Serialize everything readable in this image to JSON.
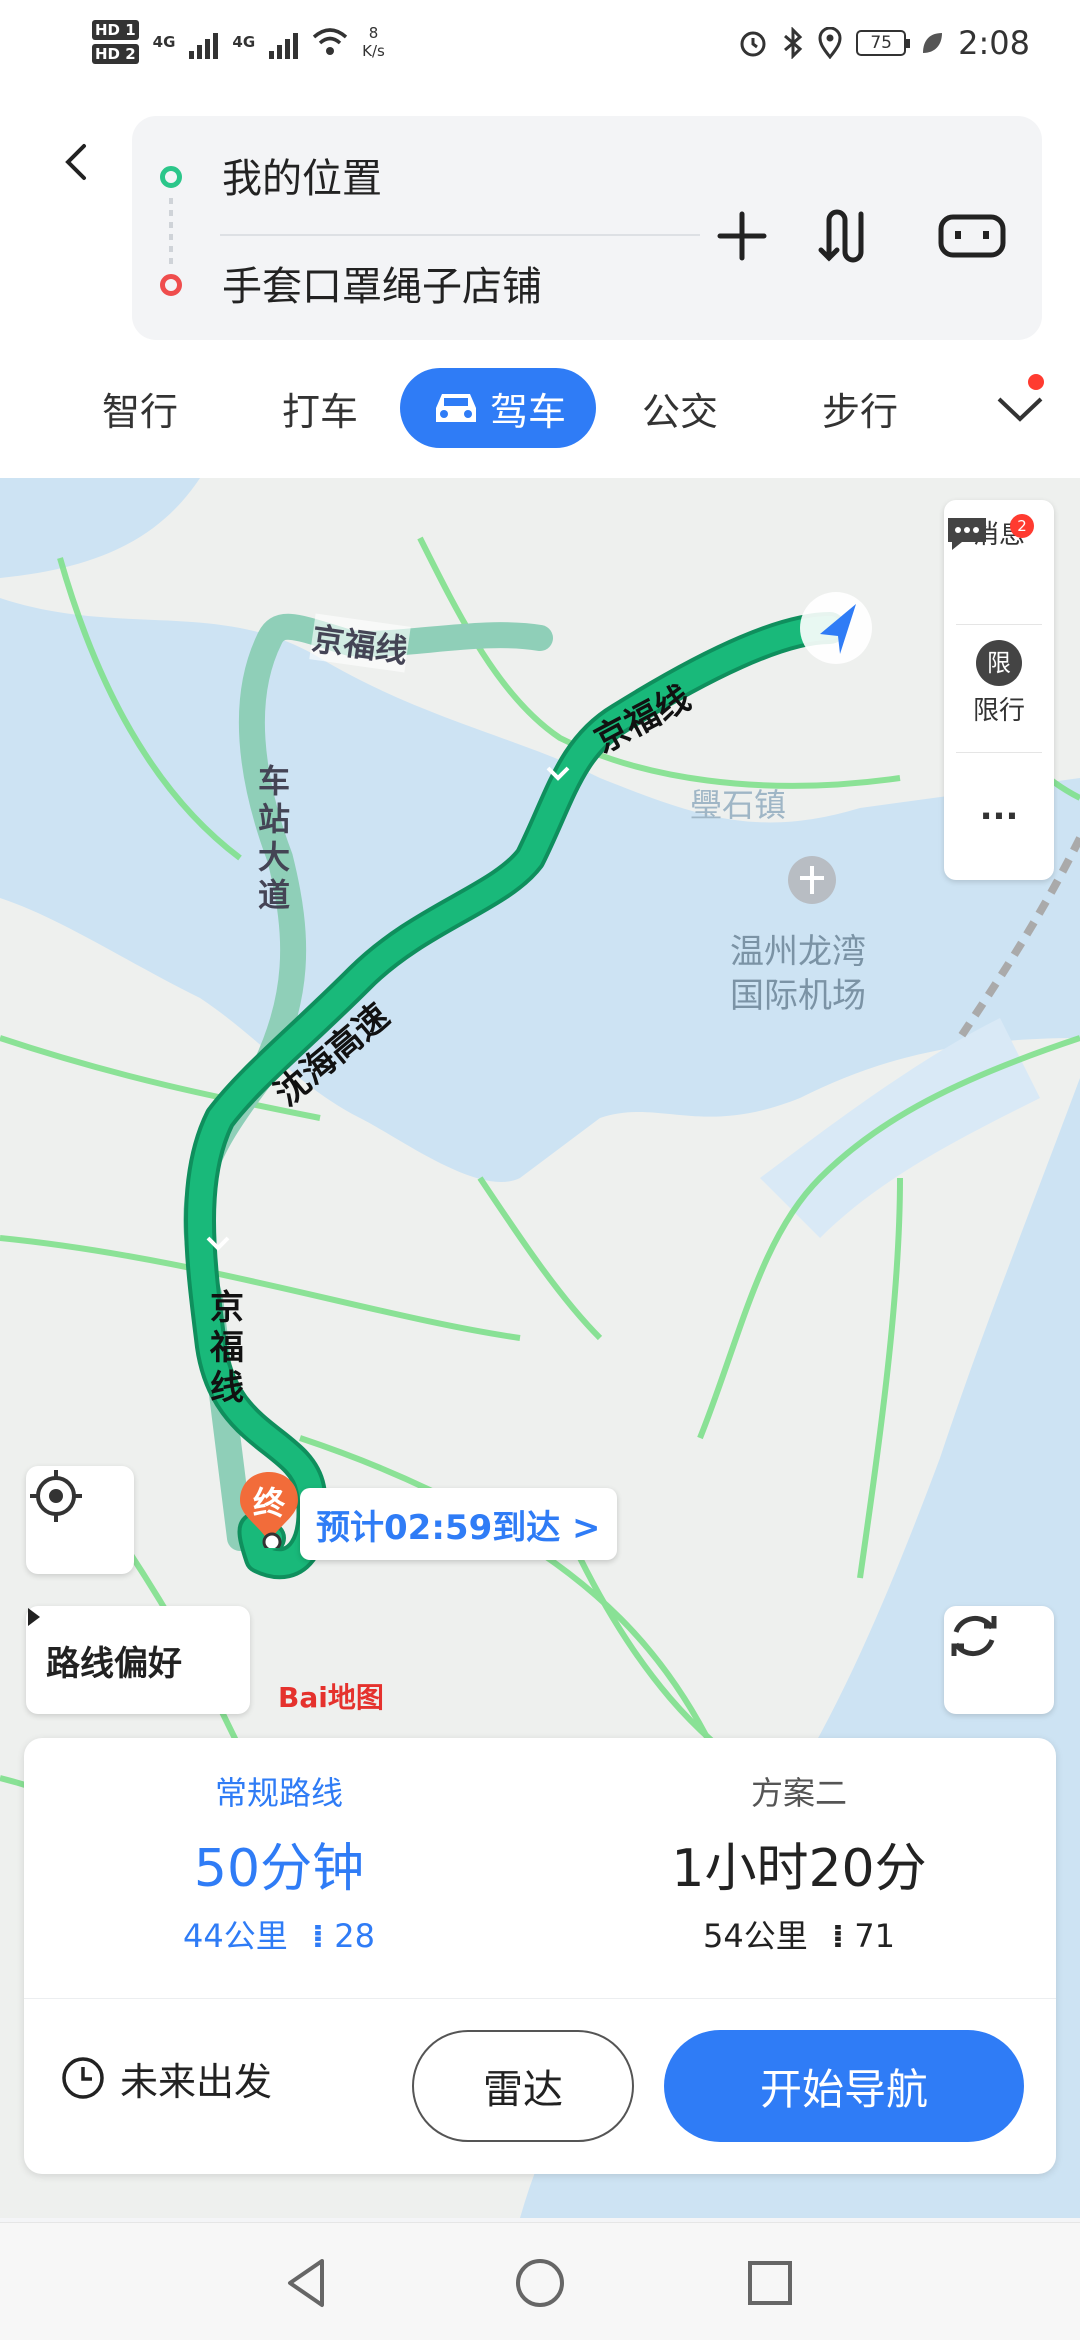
{
  "status_bar": {
    "hd1": "HD 1",
    "hd2": "HD 2",
    "net1": "4G",
    "net2": "4G",
    "speed_value": "8",
    "speed_unit": "K/s",
    "battery": "75",
    "time": "2:08",
    "icons": [
      "alarm-icon",
      "bluetooth-icon",
      "location-icon",
      "leaf-icon"
    ]
  },
  "route": {
    "start": "我的位置",
    "end": "手套口罩绳子店铺",
    "icons": [
      "back-icon",
      "add-waypoint-icon",
      "swap-icon",
      "car-settings-icon"
    ]
  },
  "tabs": [
    {
      "label": "智行"
    },
    {
      "label": "打车"
    },
    {
      "label": "驾车",
      "active": true
    },
    {
      "label": "公交"
    },
    {
      "label": "步行"
    }
  ],
  "map": {
    "labels": {
      "road1_top": "京福线",
      "road_station": "车站大道",
      "road_jingfu_right": "京福线",
      "road_shenhai": "沈海高速",
      "road_jingfu_bottom": "京福线",
      "area_lingshi": "璺石镇",
      "airport_line1": "温州龙湾",
      "airport_line2": "国际机场"
    },
    "side_tools": {
      "message": "消息",
      "message_badge": "2",
      "limit_icon_text": "限",
      "limit": "限行",
      "more": "..."
    },
    "end_marker": "终",
    "eta": "预计02:59到达 >",
    "route_pref": "路线偏好",
    "logo": "Bai地图",
    "colors": {
      "route_main": "#19b97a",
      "route_alt": "#8fcfb8",
      "water": "#cde3f3",
      "road": "#7fe08c"
    }
  },
  "plans": [
    {
      "name": "常规路线",
      "time": "50分钟",
      "distance": "44公里",
      "lights": "28"
    },
    {
      "name": "方案二",
      "time": "1小时20分",
      "distance": "54公里",
      "lights": "71"
    }
  ],
  "actions": {
    "future": "未来出发",
    "radar": "雷达",
    "start": "开始导航"
  },
  "accent_color": "#2f7cf6"
}
